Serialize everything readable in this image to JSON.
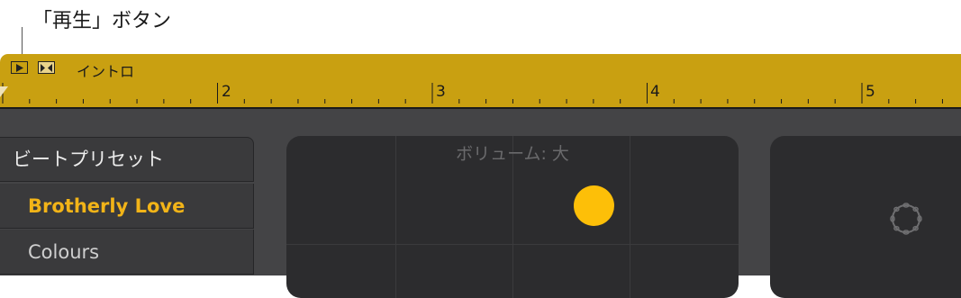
{
  "callout": {
    "text": "「再生」ボタン"
  },
  "arrangement": {
    "section_label": "イントロ",
    "bar_numbers": [
      "2",
      "3",
      "4",
      "5"
    ]
  },
  "presets": {
    "header": "ビートプリセット",
    "items": [
      {
        "label": "Brotherly Love",
        "selected": true
      },
      {
        "label": "Colours",
        "selected": false
      }
    ]
  },
  "xy_pad": {
    "label": "ボリューム: 大"
  },
  "colors": {
    "accent": "#f2b418",
    "arrangement_bar": "#c9a011",
    "puck": "#fdbf08"
  },
  "icons": {
    "play": "play-icon",
    "marker": "section-marker-icon",
    "instrument": "tambourine-icon"
  }
}
